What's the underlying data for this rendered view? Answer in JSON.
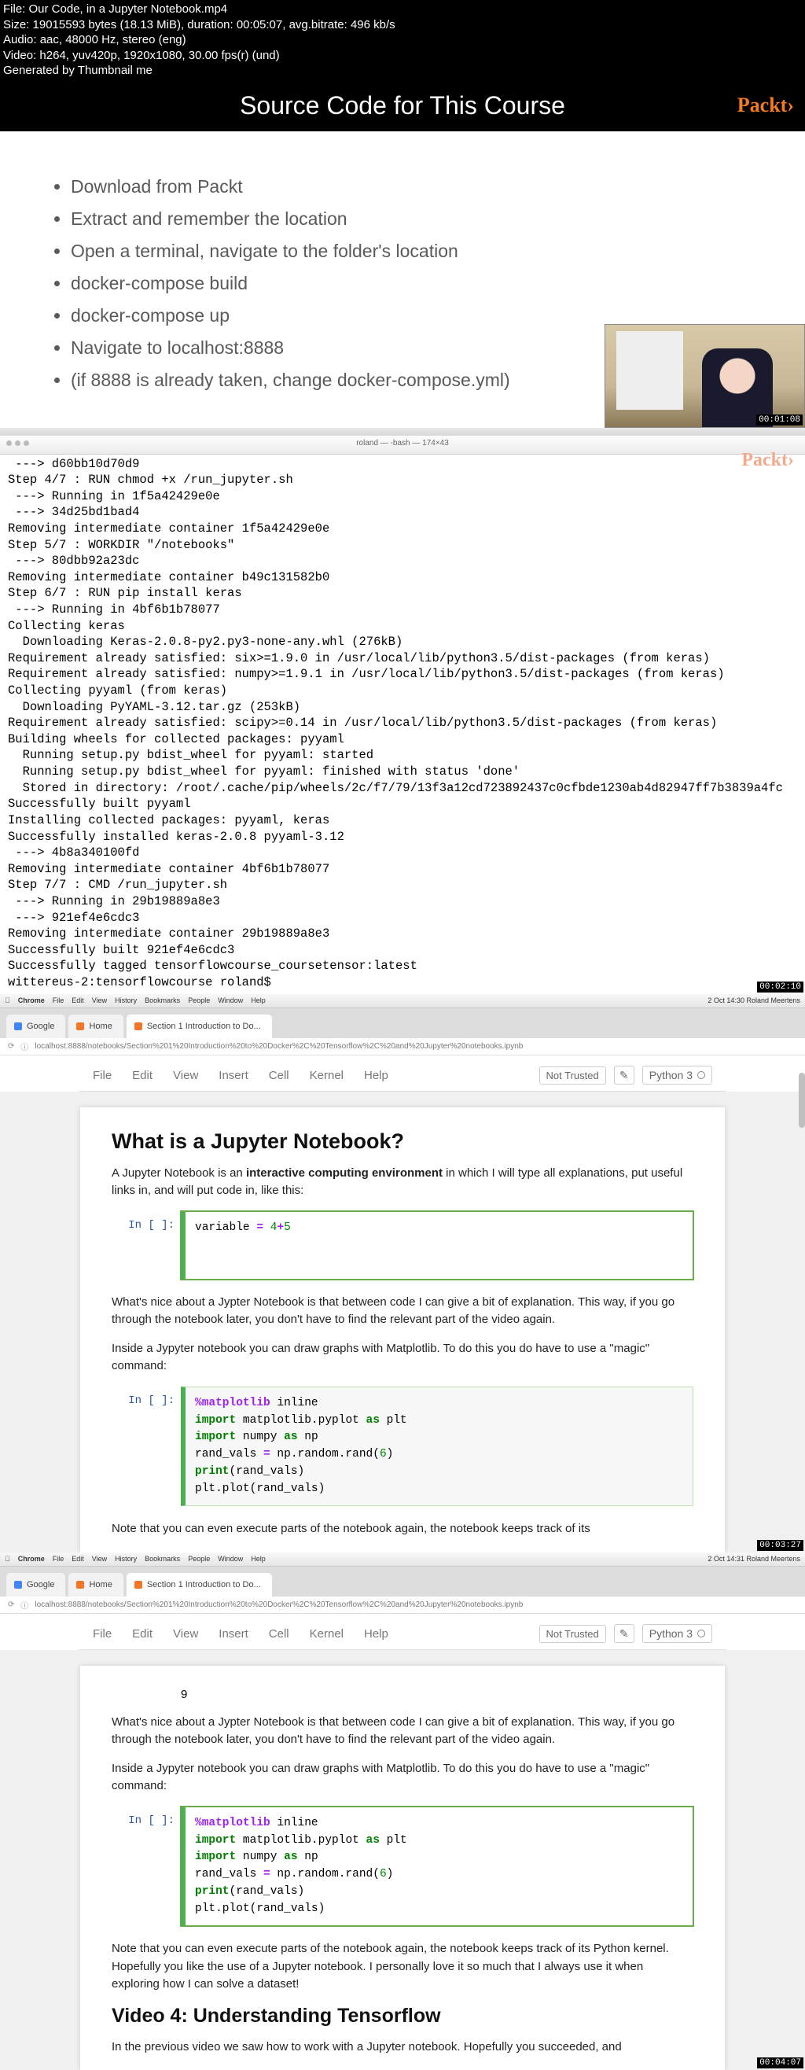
{
  "meta": {
    "l1": "File: Our Code, in a Jupyter Notebook.mp4",
    "l2": "Size: 19015593 bytes (18.13 MiB), duration: 00:05:07, avg.bitrate: 496 kb/s",
    "l3": "Audio: aac, 48000 Hz, stereo (eng)",
    "l4": "Video: h264, yuv420p, 1920x1080, 30.00 fps(r) (und)",
    "l5": "Generated by Thumbnail me"
  },
  "slide1": {
    "title": "Source Code for This Course",
    "brand": "Packt›",
    "bullets": [
      "Download from Packt",
      "Extract and remember the location",
      "Open a terminal, navigate to the folder's location",
      "docker-compose build",
      "docker-compose up",
      "Navigate to localhost:8888",
      "(if 8888 is already taken, change docker-compose.yml)"
    ],
    "tc": "00:01:08"
  },
  "slide2": {
    "brand": "Packt›",
    "tc": "00:02:10",
    "wintitle": "roland — -bash — 174×43",
    "term": " ---> d60bb10d70d9\nStep 4/7 : RUN chmod +x /run_jupyter.sh\n ---> Running in 1f5a42429e0e\n ---> 34d25bd1bad4\nRemoving intermediate container 1f5a42429e0e\nStep 5/7 : WORKDIR \"/notebooks\"\n ---> 80dbb92a23dc\nRemoving intermediate container b49c131582b0\nStep 6/7 : RUN pip install keras\n ---> Running in 4bf6b1b78077\nCollecting keras\n  Downloading Keras-2.0.8-py2.py3-none-any.whl (276kB)\nRequirement already satisfied: six>=1.9.0 in /usr/local/lib/python3.5/dist-packages (from keras)\nRequirement already satisfied: numpy>=1.9.1 in /usr/local/lib/python3.5/dist-packages (from keras)\nCollecting pyyaml (from keras)\n  Downloading PyYAML-3.12.tar.gz (253kB)\nRequirement already satisfied: scipy>=0.14 in /usr/local/lib/python3.5/dist-packages (from keras)\nBuilding wheels for collected packages: pyyaml\n  Running setup.py bdist_wheel for pyyaml: started\n  Running setup.py bdist_wheel for pyyaml: finished with status 'done'\n  Stored in directory: /root/.cache/pip/wheels/2c/f7/79/13f3a12cd723892437c0cfbde1230ab4d82947ff7b3839a4fc\nSuccessfully built pyyaml\nInstalling collected packages: pyyaml, keras\nSuccessfully installed keras-2.0.8 pyyaml-3.12\n ---> 4b8a340100fd\nRemoving intermediate container 4bf6b1b78077\nStep 7/7 : CMD /run_jupyter.sh\n ---> Running in 29b19889a8e3\n ---> 921ef4e6cdc3\nRemoving intermediate container 29b19889a8e3\nSuccessfully built 921ef4e6cdc3\nSuccessfully tagged tensorflowcourse_coursetensor:latest\nwittereus-2:tensorflowcourse roland$ "
  },
  "mac": {
    "menuItems": [
      "Chrome",
      "File",
      "Edit",
      "View",
      "History",
      "Bookmarks",
      "People",
      "Window",
      "Help"
    ],
    "right3": "2 Oct 14:30   Roland Meertens",
    "right4": "2 Oct 14:31   Roland Meertens"
  },
  "browser": {
    "tab1": "Google",
    "tab2": "Home",
    "tab3": "Section 1 Introduction to Do...",
    "url": "localhost:8888/notebooks/Section%201%20Introduction%20to%20Docker%2C%20Tensorflow%2C%20and%20Jupyter%20notebooks.ipynb"
  },
  "jup_menu": [
    "File",
    "Edit",
    "View",
    "Insert",
    "Cell",
    "Kernel",
    "Help"
  ],
  "jup_right": {
    "nt": "Not Trusted",
    "kern": "Python 3"
  },
  "jup3": {
    "tc": "00:03:27",
    "h2": "What is a Jupyter Notebook?",
    "p1a": "A Jupyter Notebook is an ",
    "p1b": "interactive computing environment",
    "p1c": " in which I will type all explanations, put useful links in, and will put code in, like this:",
    "prompt": "In [ ]:",
    "code1": "variable = 4+5",
    "p2": "What's nice about a Jypter Notebook is that between code I can give a bit of explanation. This way, if you go through the notebook later, you don't have to find the relevant part of the video again.",
    "p3": "Inside a Jypyter notebook you can draw graphs with Matplotlib. To do this you do have to use a \"magic\" command:",
    "p4": "Note that you can even execute parts of the notebook again, the notebook keeps track of its"
  },
  "jup4": {
    "tc": "00:04:07",
    "out": "9",
    "p2": "What's nice about a Jypter Notebook is that between code I can give a bit of explanation. This way, if you go through the notebook later, you don't have to find the relevant part of the video again.",
    "p3": "Inside a Jypyter notebook you can draw graphs with Matplotlib. To do this you do have to use a \"magic\" command:",
    "prompt": "In [ ]:",
    "p4": "Note that you can even execute parts of the notebook again, the notebook keeps track of its Python kernel. Hopefully you like the use of a Jupyter notebook. I personally love it so much that I always use it when exploring how I can solve a dataset!",
    "h2": "Video 4: Understanding Tensorflow",
    "p5": "In the previous video we saw how to work with a Jupyter notebook. Hopefully you succeeded, and"
  },
  "code2": {
    "l1a": "%matplotlib",
    "l1b": " inline",
    "l2a": "import",
    "l2b": " matplotlib.pyplot ",
    "l2c": "as",
    "l2d": " plt",
    "l3a": "import",
    "l3b": " numpy ",
    "l3c": "as",
    "l3d": " np",
    "l4": "rand_vals = np.random.rand(6)",
    "l5a": "print",
    "l5b": "(rand_vals)",
    "l6": "plt.plot(rand_vals)"
  }
}
